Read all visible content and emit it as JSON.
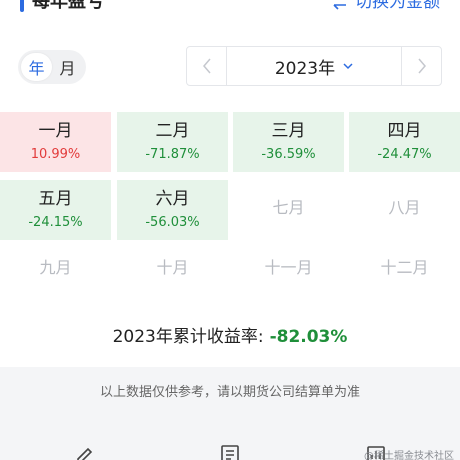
{
  "header": {
    "title": "每年盈亏",
    "switch_label": "切换为金额"
  },
  "toggle": {
    "year_label": "年",
    "month_label": "月",
    "selected": "年"
  },
  "year_picker": {
    "value": "2023年"
  },
  "months": [
    {
      "name": "一月",
      "value": "10.99%",
      "status": "loss"
    },
    {
      "name": "二月",
      "value": "-71.87%",
      "status": "gain"
    },
    {
      "name": "三月",
      "value": "-36.59%",
      "status": "gain"
    },
    {
      "name": "四月",
      "value": "-24.47%",
      "status": "gain"
    },
    {
      "name": "五月",
      "value": "-24.15%",
      "status": "gain"
    },
    {
      "name": "六月",
      "value": "-56.03%",
      "status": "gain"
    },
    {
      "name": "七月",
      "value": "",
      "status": "empty"
    },
    {
      "name": "八月",
      "value": "",
      "status": "empty"
    },
    {
      "name": "九月",
      "value": "",
      "status": "empty"
    },
    {
      "name": "十月",
      "value": "",
      "status": "empty"
    },
    {
      "name": "十一月",
      "value": "",
      "status": "empty"
    },
    {
      "name": "十二月",
      "value": "",
      "status": "empty"
    }
  ],
  "summary": {
    "label": "2023年累计收益率:",
    "value": "-82.03%"
  },
  "footer": {
    "note": "以上数据仅供参考，请以期货公司结算单为准",
    "watermark": "@稀土掘金技术社区"
  },
  "colors": {
    "accent": "#2c6be0",
    "loss_bg": "#fce4e6",
    "loss_text": "#e23b3b",
    "gain_bg": "#e7f4ea",
    "gain_text": "#1f8f3a"
  }
}
